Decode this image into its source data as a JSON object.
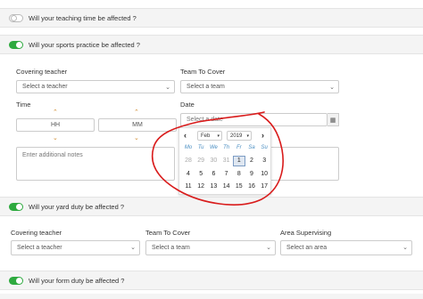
{
  "teaching": {
    "label": "Will your teaching time be affected ?",
    "toggle": "off"
  },
  "sports": {
    "label": "Will your sports practice be affected ?",
    "toggle": "on",
    "covering_teacher_label": "Covering teacher",
    "covering_teacher_value": "Select a teacher",
    "team_label": "Team To Cover",
    "team_value": "Select a team",
    "time_label": "Time",
    "hh": "HH",
    "mm": "MM",
    "date_label": "Date",
    "date_placeholder": "Select a date",
    "notes_placeholder": "Enter additional notes"
  },
  "datepicker": {
    "month": "Feb",
    "year": "2019",
    "weekdays": [
      "Mo",
      "Tu",
      "We",
      "Th",
      "Fr",
      "Sa",
      "Su"
    ],
    "rows": [
      [
        "28",
        "29",
        "30",
        "31",
        "1",
        "2",
        "3"
      ],
      [
        "4",
        "5",
        "6",
        "7",
        "8",
        "9",
        "10"
      ],
      [
        "11",
        "12",
        "13",
        "14",
        "15",
        "16",
        "17"
      ]
    ],
    "muted_days": [
      "28",
      "29",
      "30",
      "31"
    ],
    "selected_day": "1"
  },
  "yard": {
    "label": "Will your yard duty be affected ?",
    "toggle": "on",
    "covering_teacher_label": "Covering teacher",
    "covering_teacher_value": "Select a teacher",
    "team_label": "Team To Cover",
    "team_value": "Select a team",
    "area_label": "Area Supervising",
    "area_value": "Select an area"
  },
  "form": {
    "label": "Will your form duty be affected ?",
    "toggle": "on"
  },
  "colors": {
    "toggle_on": "#2eaa3f",
    "annotation": "#d91c1c",
    "weekday": "#4a8ec2"
  },
  "icons": {
    "chevron": "chevron-down-icon",
    "calendar": "calendar-icon",
    "spinner": "spinner-arrows-icon"
  }
}
